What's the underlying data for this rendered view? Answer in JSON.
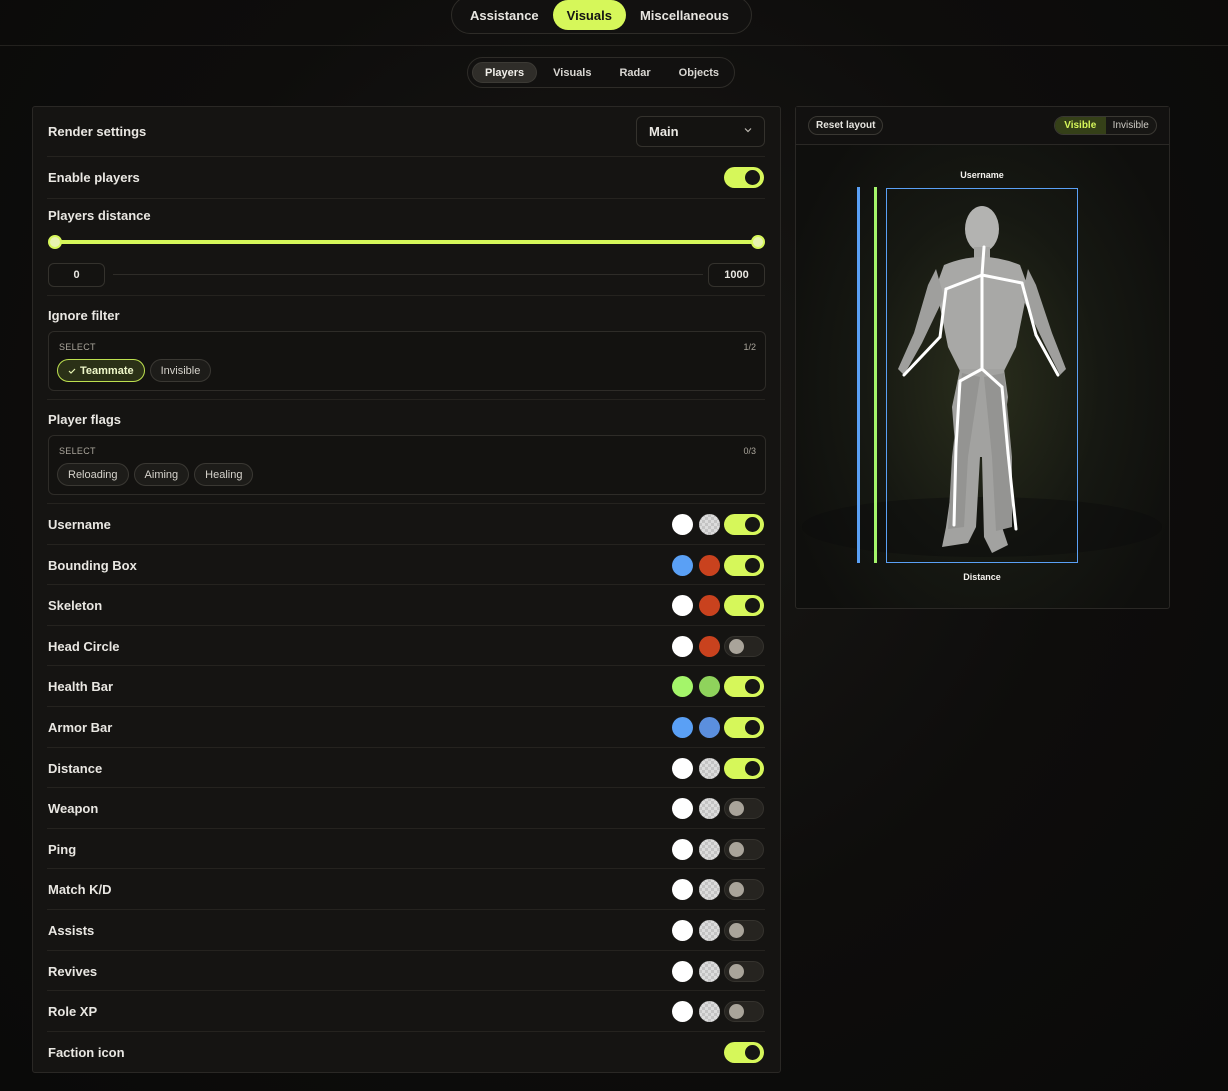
{
  "main_tabs": [
    "Assistance",
    "Visuals",
    "Miscellaneous"
  ],
  "sub_tabs": [
    "Players",
    "Visuals",
    "Radar",
    "Objects"
  ],
  "render_settings": {
    "label": "Render settings",
    "value": "Main"
  },
  "enable_players": {
    "label": "Enable players",
    "on": true
  },
  "players_distance": {
    "label": "Players distance",
    "min": "0",
    "max": "1000"
  },
  "ignore_filter": {
    "label": "Ignore filter",
    "select_label": "SELECT",
    "count": "1/2",
    "chips": [
      {
        "label": "Teammate",
        "active": true
      },
      {
        "label": "Invisible",
        "active": false
      }
    ]
  },
  "player_flags": {
    "label": "Player flags",
    "select_label": "SELECT",
    "count": "0/3",
    "chips": [
      {
        "label": "Reloading"
      },
      {
        "label": "Aiming"
      },
      {
        "label": "Healing"
      }
    ]
  },
  "features": [
    {
      "label": "Username",
      "c1": "#ffffff",
      "c2": "checker",
      "on": true
    },
    {
      "label": "Bounding Box",
      "c1": "#5aa0f5",
      "c2": "#c9421e",
      "on": true
    },
    {
      "label": "Skeleton",
      "c1": "#ffffff",
      "c2": "#c9421e",
      "on": true
    },
    {
      "label": "Head Circle",
      "c1": "#ffffff",
      "c2": "#c9421e",
      "on": false
    },
    {
      "label": "Health Bar",
      "c1": "#a4f56a",
      "c2": "#8fd35c",
      "on": true
    },
    {
      "label": "Armor Bar",
      "c1": "#5aa0f5",
      "c2": "#5b8fde",
      "on": true
    },
    {
      "label": "Distance",
      "c1": "#ffffff",
      "c2": "checker",
      "on": true
    },
    {
      "label": "Weapon",
      "c1": "#ffffff",
      "c2": "checker",
      "on": false
    },
    {
      "label": "Ping",
      "c1": "#ffffff",
      "c2": "checker",
      "on": false
    },
    {
      "label": "Match K/D",
      "c1": "#ffffff",
      "c2": "checker",
      "on": false
    },
    {
      "label": "Assists",
      "c1": "#ffffff",
      "c2": "checker",
      "on": false
    },
    {
      "label": "Revives",
      "c1": "#ffffff",
      "c2": "checker",
      "on": false
    },
    {
      "label": "Role XP",
      "c1": "#ffffff",
      "c2": "checker",
      "on": false
    },
    {
      "label": "Faction icon",
      "c1": null,
      "c2": null,
      "on": true
    }
  ],
  "preview": {
    "reset_label": "Reset layout",
    "visibility": [
      "Visible",
      "Invisible"
    ],
    "username_label": "Username",
    "distance_label": "Distance"
  },
  "colors": {
    "accent": "#d6f75a",
    "box": "#5aa0f5",
    "health": "#a4f56a"
  }
}
